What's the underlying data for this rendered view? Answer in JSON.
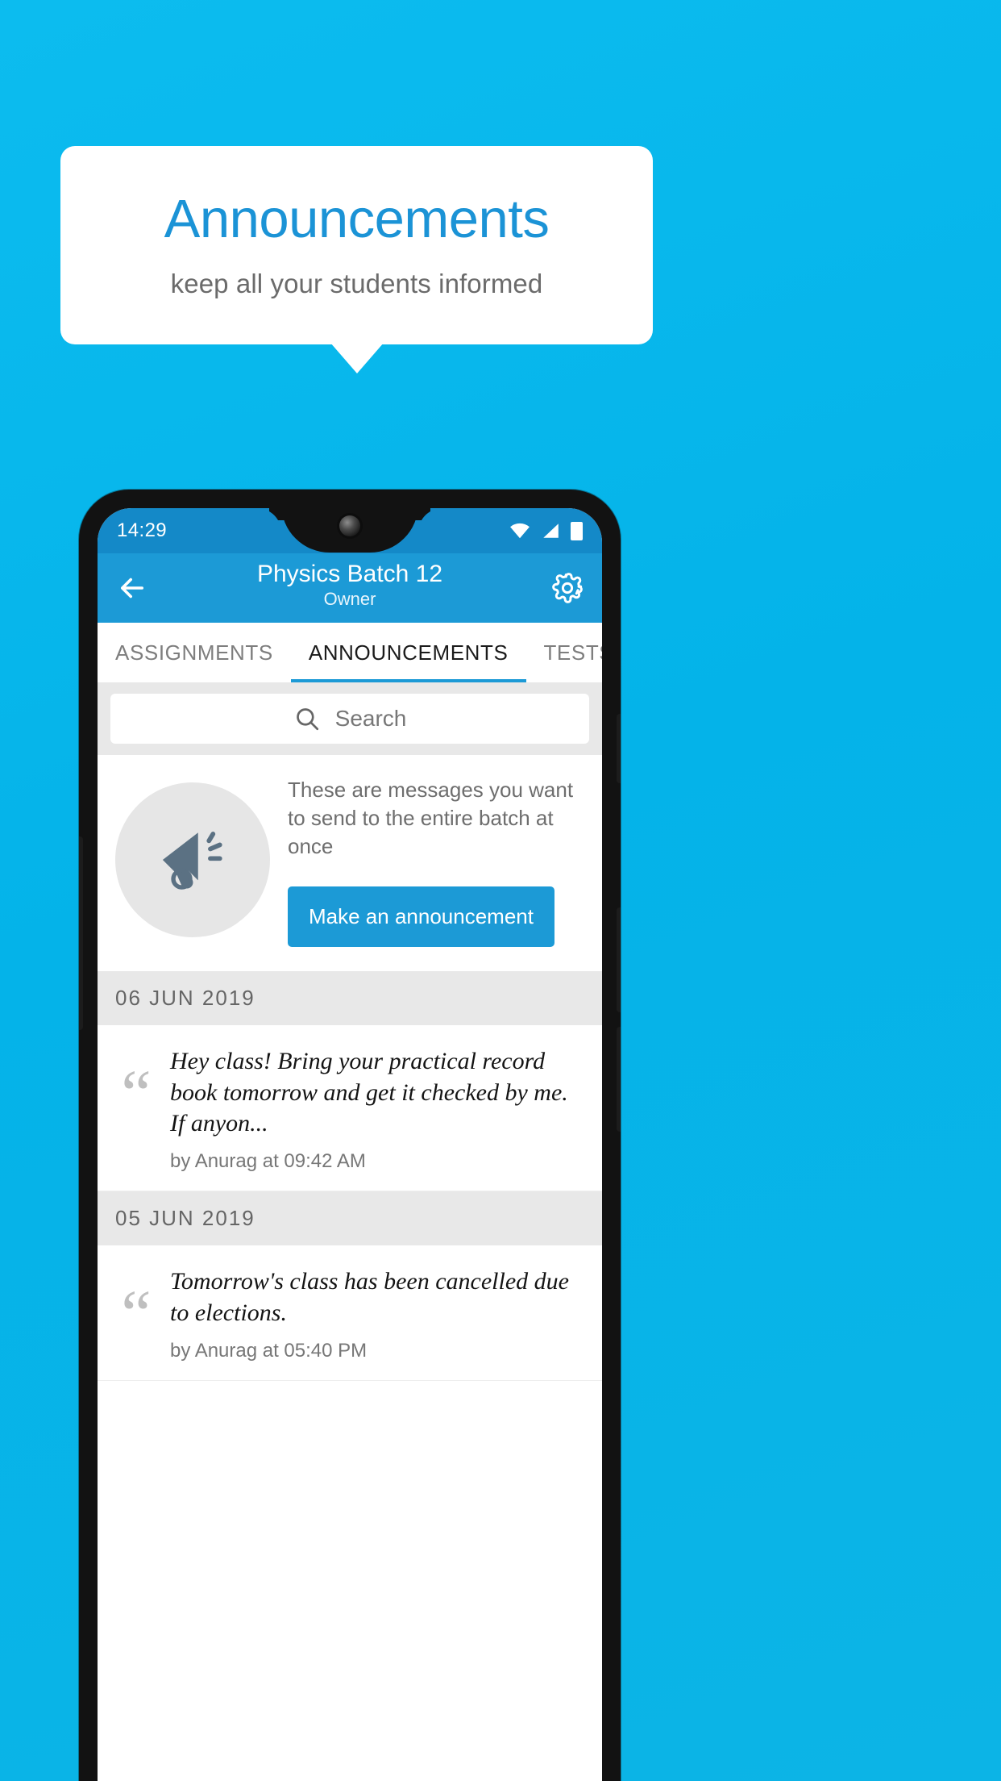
{
  "promo": {
    "title": "Announcements",
    "subtitle": "keep all your students informed",
    "bg_color": "#0bb8ec",
    "title_color": "#1b93d6"
  },
  "phone": {
    "statusbar": {
      "time": "14:29",
      "icons": [
        "wifi-icon",
        "signal-icon",
        "battery-icon"
      ]
    },
    "appbar": {
      "back_icon": "back-arrow-icon",
      "title": "Physics Batch 12",
      "subtitle": "Owner",
      "settings_icon": "gear-icon",
      "color": "#1c9ad6"
    },
    "tabs": [
      {
        "label": "ASSIGNMENTS",
        "active": false
      },
      {
        "label": "ANNOUNCEMENTS",
        "active": true
      },
      {
        "label": "TESTS",
        "active": false
      }
    ],
    "search": {
      "icon": "search-icon",
      "placeholder": "Search",
      "value": ""
    },
    "empty_promo": {
      "icon": "megaphone-icon",
      "text": "These are messages you want to send to the entire batch at once",
      "button_label": "Make an announcement"
    },
    "groups": [
      {
        "date": "06  JUN  2019",
        "items": [
          {
            "text": "Hey class! Bring your practical record book tomorrow and get it checked by me. If anyon...",
            "by": "by Anurag at 09:42 AM"
          }
        ]
      },
      {
        "date": "05  JUN  2019",
        "items": [
          {
            "text": "Tomorrow's class has been cancelled due to elections.",
            "by": "by Anurag at 05:40 PM"
          }
        ]
      }
    ]
  }
}
